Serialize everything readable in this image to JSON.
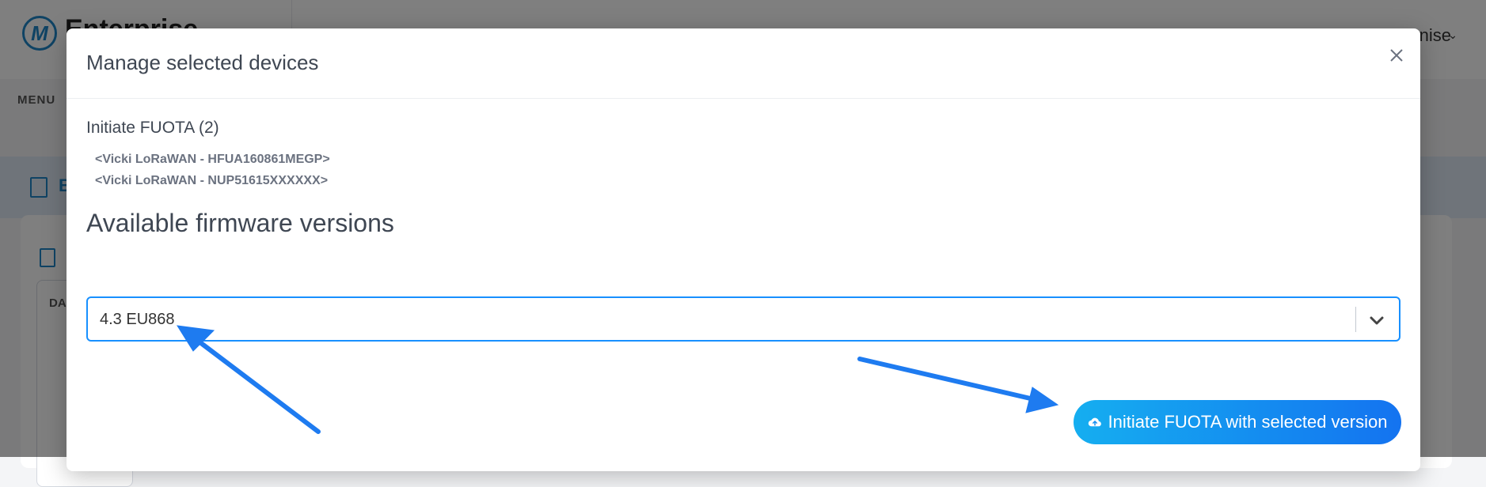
{
  "background": {
    "logo_letter": "M",
    "logo_text": "Enterprise",
    "user_name": "Denise",
    "menu_label": "MENU",
    "nav_item_label": "B",
    "card_label": "DA"
  },
  "modal": {
    "title": "Manage selected devices",
    "section_title": "Initiate FUOTA (2)",
    "devices": [
      "<Vicki LoRaWAN - HFUA160861MEGP>",
      "<Vicki LoRaWAN - NUP51615XXXXXX>"
    ],
    "firmware_heading": "Available firmware versions",
    "firmware_select": {
      "value": "4.3 EU868"
    },
    "action_button_label": "Initiate FUOTA with selected version"
  },
  "colors": {
    "accent": "#1890ff",
    "button_gradient_start": "#15aef0",
    "button_gradient_end": "#1473f0",
    "annotation_arrow": "#1e7bf0"
  },
  "icons": {
    "close": "close-icon",
    "select": "chevron-down-icon",
    "button": "cloud-upload-icon"
  }
}
